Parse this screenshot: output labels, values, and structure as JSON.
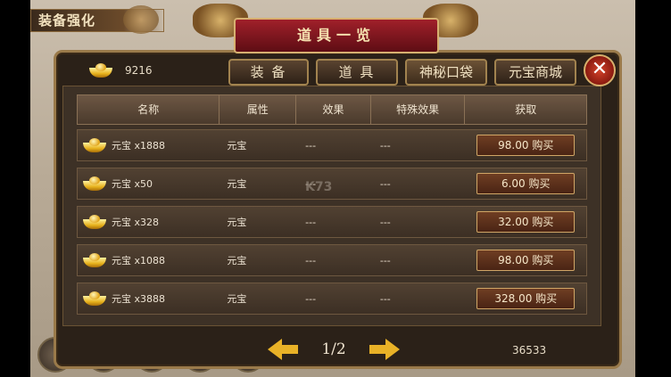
{
  "corner": {
    "label": "装备强化"
  },
  "title": "道具一览",
  "gold": {
    "amount": "9216"
  },
  "tabs": [
    {
      "label": "装 备"
    },
    {
      "label": "道 具"
    },
    {
      "label": "神秘口袋"
    },
    {
      "label": "元宝商城"
    }
  ],
  "close": {
    "label": "✕"
  },
  "table": {
    "headers": [
      "名称",
      "属性",
      "效果",
      "特殊效果",
      "获取"
    ],
    "rows": [
      {
        "name": "元宝 x1888",
        "attr": "元宝",
        "effect": "---",
        "special": "---",
        "buy": "98.00 购买"
      },
      {
        "name": "元宝 x50",
        "attr": "元宝",
        "effect": "---",
        "special": "---",
        "buy": "6.00 购买"
      },
      {
        "name": "元宝 x328",
        "attr": "元宝",
        "effect": "---",
        "special": "---",
        "buy": "32.00 购买"
      },
      {
        "name": "元宝 x1088",
        "attr": "元宝",
        "effect": "---",
        "special": "---",
        "buy": "98.00 购买"
      },
      {
        "name": "元宝 x3888",
        "attr": "元宝",
        "effect": "---",
        "special": "---",
        "buy": "328.00 购买"
      }
    ]
  },
  "pager": {
    "text": "1/2"
  },
  "bottom": {
    "number": "36533"
  },
  "watermark": {
    "text": "K73"
  },
  "colors": {
    "accent": "#e9b227",
    "panel": "#2b2118",
    "banner": "#a0202a"
  }
}
